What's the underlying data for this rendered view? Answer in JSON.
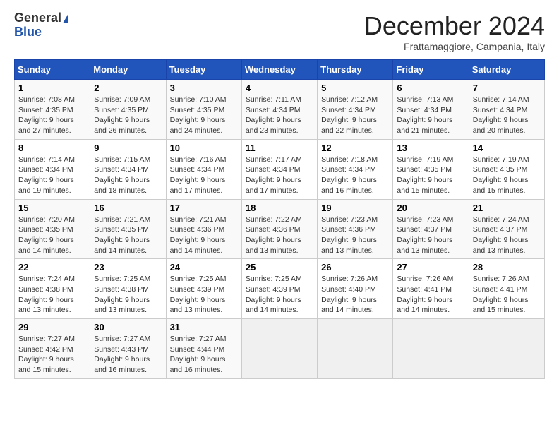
{
  "header": {
    "logo_general": "General",
    "logo_blue": "Blue",
    "month_title": "December 2024",
    "location": "Frattamaggiore, Campania, Italy"
  },
  "weekdays": [
    "Sunday",
    "Monday",
    "Tuesday",
    "Wednesday",
    "Thursday",
    "Friday",
    "Saturday"
  ],
  "weeks": [
    [
      {
        "day": "1",
        "sunrise": "Sunrise: 7:08 AM",
        "sunset": "Sunset: 4:35 PM",
        "daylight": "Daylight: 9 hours and 27 minutes."
      },
      {
        "day": "2",
        "sunrise": "Sunrise: 7:09 AM",
        "sunset": "Sunset: 4:35 PM",
        "daylight": "Daylight: 9 hours and 26 minutes."
      },
      {
        "day": "3",
        "sunrise": "Sunrise: 7:10 AM",
        "sunset": "Sunset: 4:35 PM",
        "daylight": "Daylight: 9 hours and 24 minutes."
      },
      {
        "day": "4",
        "sunrise": "Sunrise: 7:11 AM",
        "sunset": "Sunset: 4:34 PM",
        "daylight": "Daylight: 9 hours and 23 minutes."
      },
      {
        "day": "5",
        "sunrise": "Sunrise: 7:12 AM",
        "sunset": "Sunset: 4:34 PM",
        "daylight": "Daylight: 9 hours and 22 minutes."
      },
      {
        "day": "6",
        "sunrise": "Sunrise: 7:13 AM",
        "sunset": "Sunset: 4:34 PM",
        "daylight": "Daylight: 9 hours and 21 minutes."
      },
      {
        "day": "7",
        "sunrise": "Sunrise: 7:14 AM",
        "sunset": "Sunset: 4:34 PM",
        "daylight": "Daylight: 9 hours and 20 minutes."
      }
    ],
    [
      {
        "day": "8",
        "sunrise": "Sunrise: 7:14 AM",
        "sunset": "Sunset: 4:34 PM",
        "daylight": "Daylight: 9 hours and 19 minutes."
      },
      {
        "day": "9",
        "sunrise": "Sunrise: 7:15 AM",
        "sunset": "Sunset: 4:34 PM",
        "daylight": "Daylight: 9 hours and 18 minutes."
      },
      {
        "day": "10",
        "sunrise": "Sunrise: 7:16 AM",
        "sunset": "Sunset: 4:34 PM",
        "daylight": "Daylight: 9 hours and 17 minutes."
      },
      {
        "day": "11",
        "sunrise": "Sunrise: 7:17 AM",
        "sunset": "Sunset: 4:34 PM",
        "daylight": "Daylight: 9 hours and 17 minutes."
      },
      {
        "day": "12",
        "sunrise": "Sunrise: 7:18 AM",
        "sunset": "Sunset: 4:34 PM",
        "daylight": "Daylight: 9 hours and 16 minutes."
      },
      {
        "day": "13",
        "sunrise": "Sunrise: 7:19 AM",
        "sunset": "Sunset: 4:35 PM",
        "daylight": "Daylight: 9 hours and 15 minutes."
      },
      {
        "day": "14",
        "sunrise": "Sunrise: 7:19 AM",
        "sunset": "Sunset: 4:35 PM",
        "daylight": "Daylight: 9 hours and 15 minutes."
      }
    ],
    [
      {
        "day": "15",
        "sunrise": "Sunrise: 7:20 AM",
        "sunset": "Sunset: 4:35 PM",
        "daylight": "Daylight: 9 hours and 14 minutes."
      },
      {
        "day": "16",
        "sunrise": "Sunrise: 7:21 AM",
        "sunset": "Sunset: 4:35 PM",
        "daylight": "Daylight: 9 hours and 14 minutes."
      },
      {
        "day": "17",
        "sunrise": "Sunrise: 7:21 AM",
        "sunset": "Sunset: 4:36 PM",
        "daylight": "Daylight: 9 hours and 14 minutes."
      },
      {
        "day": "18",
        "sunrise": "Sunrise: 7:22 AM",
        "sunset": "Sunset: 4:36 PM",
        "daylight": "Daylight: 9 hours and 13 minutes."
      },
      {
        "day": "19",
        "sunrise": "Sunrise: 7:23 AM",
        "sunset": "Sunset: 4:36 PM",
        "daylight": "Daylight: 9 hours and 13 minutes."
      },
      {
        "day": "20",
        "sunrise": "Sunrise: 7:23 AM",
        "sunset": "Sunset: 4:37 PM",
        "daylight": "Daylight: 9 hours and 13 minutes."
      },
      {
        "day": "21",
        "sunrise": "Sunrise: 7:24 AM",
        "sunset": "Sunset: 4:37 PM",
        "daylight": "Daylight: 9 hours and 13 minutes."
      }
    ],
    [
      {
        "day": "22",
        "sunrise": "Sunrise: 7:24 AM",
        "sunset": "Sunset: 4:38 PM",
        "daylight": "Daylight: 9 hours and 13 minutes."
      },
      {
        "day": "23",
        "sunrise": "Sunrise: 7:25 AM",
        "sunset": "Sunset: 4:38 PM",
        "daylight": "Daylight: 9 hours and 13 minutes."
      },
      {
        "day": "24",
        "sunrise": "Sunrise: 7:25 AM",
        "sunset": "Sunset: 4:39 PM",
        "daylight": "Daylight: 9 hours and 13 minutes."
      },
      {
        "day": "25",
        "sunrise": "Sunrise: 7:25 AM",
        "sunset": "Sunset: 4:39 PM",
        "daylight": "Daylight: 9 hours and 14 minutes."
      },
      {
        "day": "26",
        "sunrise": "Sunrise: 7:26 AM",
        "sunset": "Sunset: 4:40 PM",
        "daylight": "Daylight: 9 hours and 14 minutes."
      },
      {
        "day": "27",
        "sunrise": "Sunrise: 7:26 AM",
        "sunset": "Sunset: 4:41 PM",
        "daylight": "Daylight: 9 hours and 14 minutes."
      },
      {
        "day": "28",
        "sunrise": "Sunrise: 7:26 AM",
        "sunset": "Sunset: 4:41 PM",
        "daylight": "Daylight: 9 hours and 15 minutes."
      }
    ],
    [
      {
        "day": "29",
        "sunrise": "Sunrise: 7:27 AM",
        "sunset": "Sunset: 4:42 PM",
        "daylight": "Daylight: 9 hours and 15 minutes."
      },
      {
        "day": "30",
        "sunrise": "Sunrise: 7:27 AM",
        "sunset": "Sunset: 4:43 PM",
        "daylight": "Daylight: 9 hours and 16 minutes."
      },
      {
        "day": "31",
        "sunrise": "Sunrise: 7:27 AM",
        "sunset": "Sunset: 4:44 PM",
        "daylight": "Daylight: 9 hours and 16 minutes."
      },
      null,
      null,
      null,
      null
    ]
  ]
}
